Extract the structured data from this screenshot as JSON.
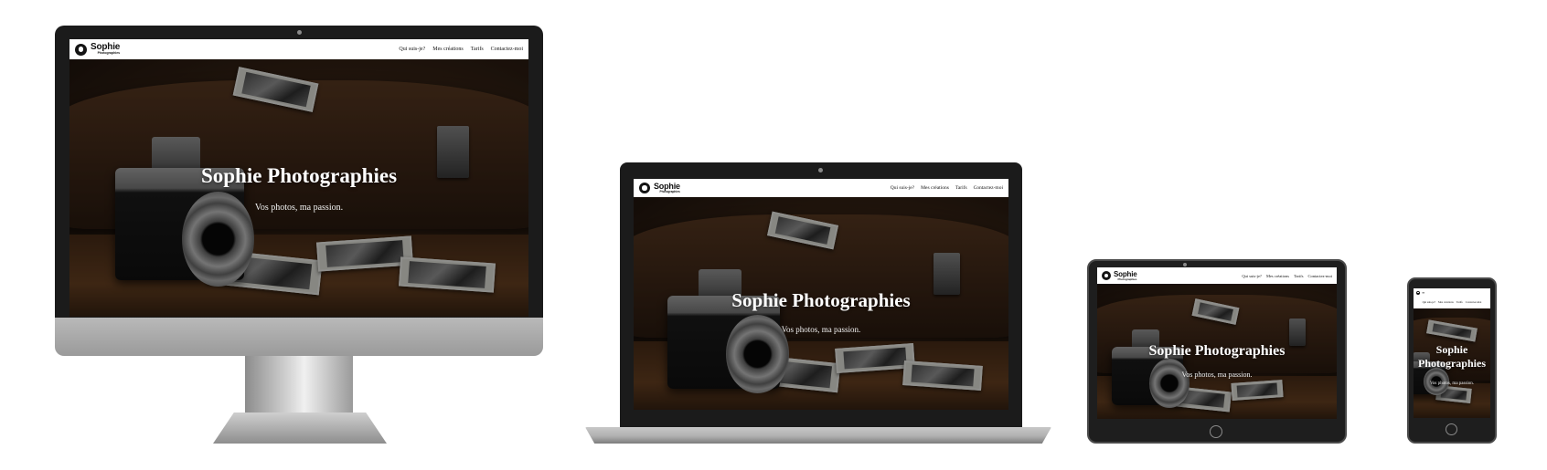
{
  "site": {
    "logo_name": "Sophie",
    "logo_sub": "Photographies",
    "nav": [
      "Qui suis-je?",
      "Mes créations",
      "Tarifs",
      "Contactez-moi"
    ],
    "hero_title": "Sophie Photographies",
    "hero_subtitle": "Vos photos, ma passion."
  },
  "devices": [
    "desktop-monitor",
    "laptop",
    "tablet",
    "phone"
  ],
  "icons": {
    "logo": "aperture-icon",
    "phone_menu": "hamburger-menu-icon"
  },
  "colors": {
    "header_bg": "#ffffff",
    "hero_text": "#ffffff",
    "device_frame": "#1b1b1b",
    "stand_silver": "#b9b9b9"
  }
}
